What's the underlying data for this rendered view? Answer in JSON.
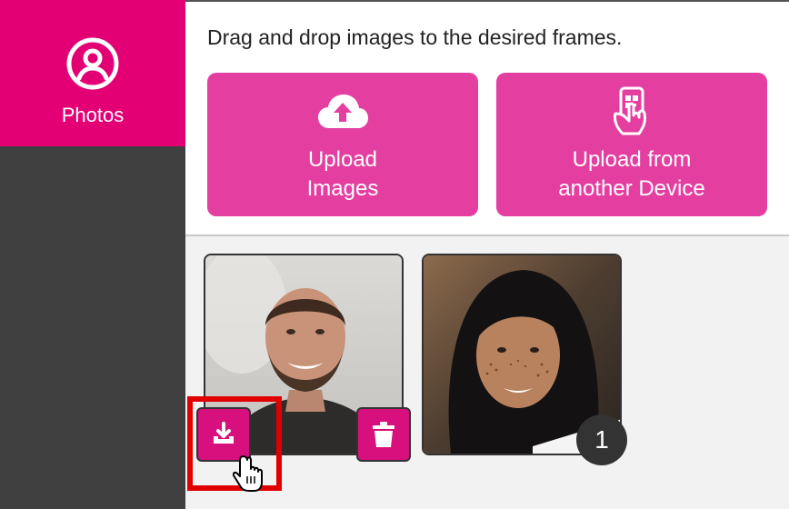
{
  "sidebar": {
    "items": [
      {
        "label": "Photos",
        "icon": "user-circle-icon",
        "active": true
      }
    ]
  },
  "upload": {
    "instruction": "Drag and drop images to the desired frames.",
    "buttons": [
      {
        "label": "Upload\nImages",
        "icon": "cloud-upload-icon"
      },
      {
        "label": "Upload from\nanother Device",
        "icon": "phone-qr-icon"
      }
    ]
  },
  "gallery": {
    "photos": [
      {
        "subject": "man-with-beard",
        "actions": [
          "download-icon",
          "trash-icon"
        ],
        "hovered": true
      },
      {
        "subject": "woman-with-freckles",
        "usage_count": "1"
      }
    ]
  },
  "colors": {
    "brand_magenta": "#e20074",
    "button_pink": "#e43ea0",
    "action_button": "#d8107e",
    "sidebar_bg": "#404040",
    "highlight_red": "#e00000"
  }
}
